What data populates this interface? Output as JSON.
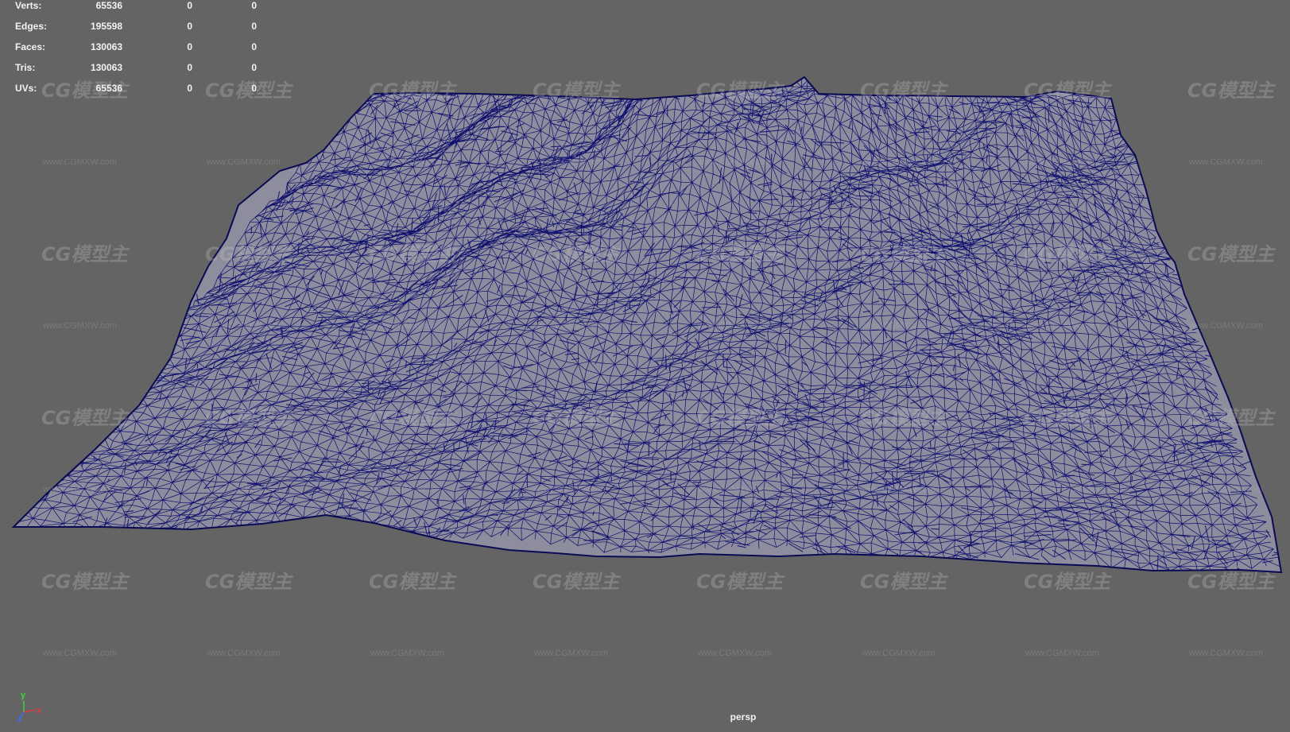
{
  "hud": {
    "rows": [
      {
        "label": "Verts:",
        "v1": "65536",
        "v2": "0",
        "v3": "0"
      },
      {
        "label": "Edges:",
        "v1": "195598",
        "v2": "0",
        "v3": "0"
      },
      {
        "label": "Faces:",
        "v1": "130063",
        "v2": "0",
        "v3": "0"
      },
      {
        "label": "Tris:",
        "v1": "130063",
        "v2": "0",
        "v3": "0"
      },
      {
        "label": "UVs:",
        "v1": "65536",
        "v2": "0",
        "v3": "0"
      }
    ]
  },
  "viewport": {
    "camera": "persp",
    "background_color": "#646464",
    "wire_color": "#0d0d6e",
    "fill_color": "#8a8a9a"
  },
  "axis": {
    "y_label": "y",
    "x_label": "x",
    "z_label": "z",
    "y_color": "#3fd13f",
    "x_color": "#e03c3c",
    "z_color": "#3c6cff"
  },
  "watermark": {
    "logo_text": "CG模型主",
    "url_text": "www.CGMXW.com"
  }
}
